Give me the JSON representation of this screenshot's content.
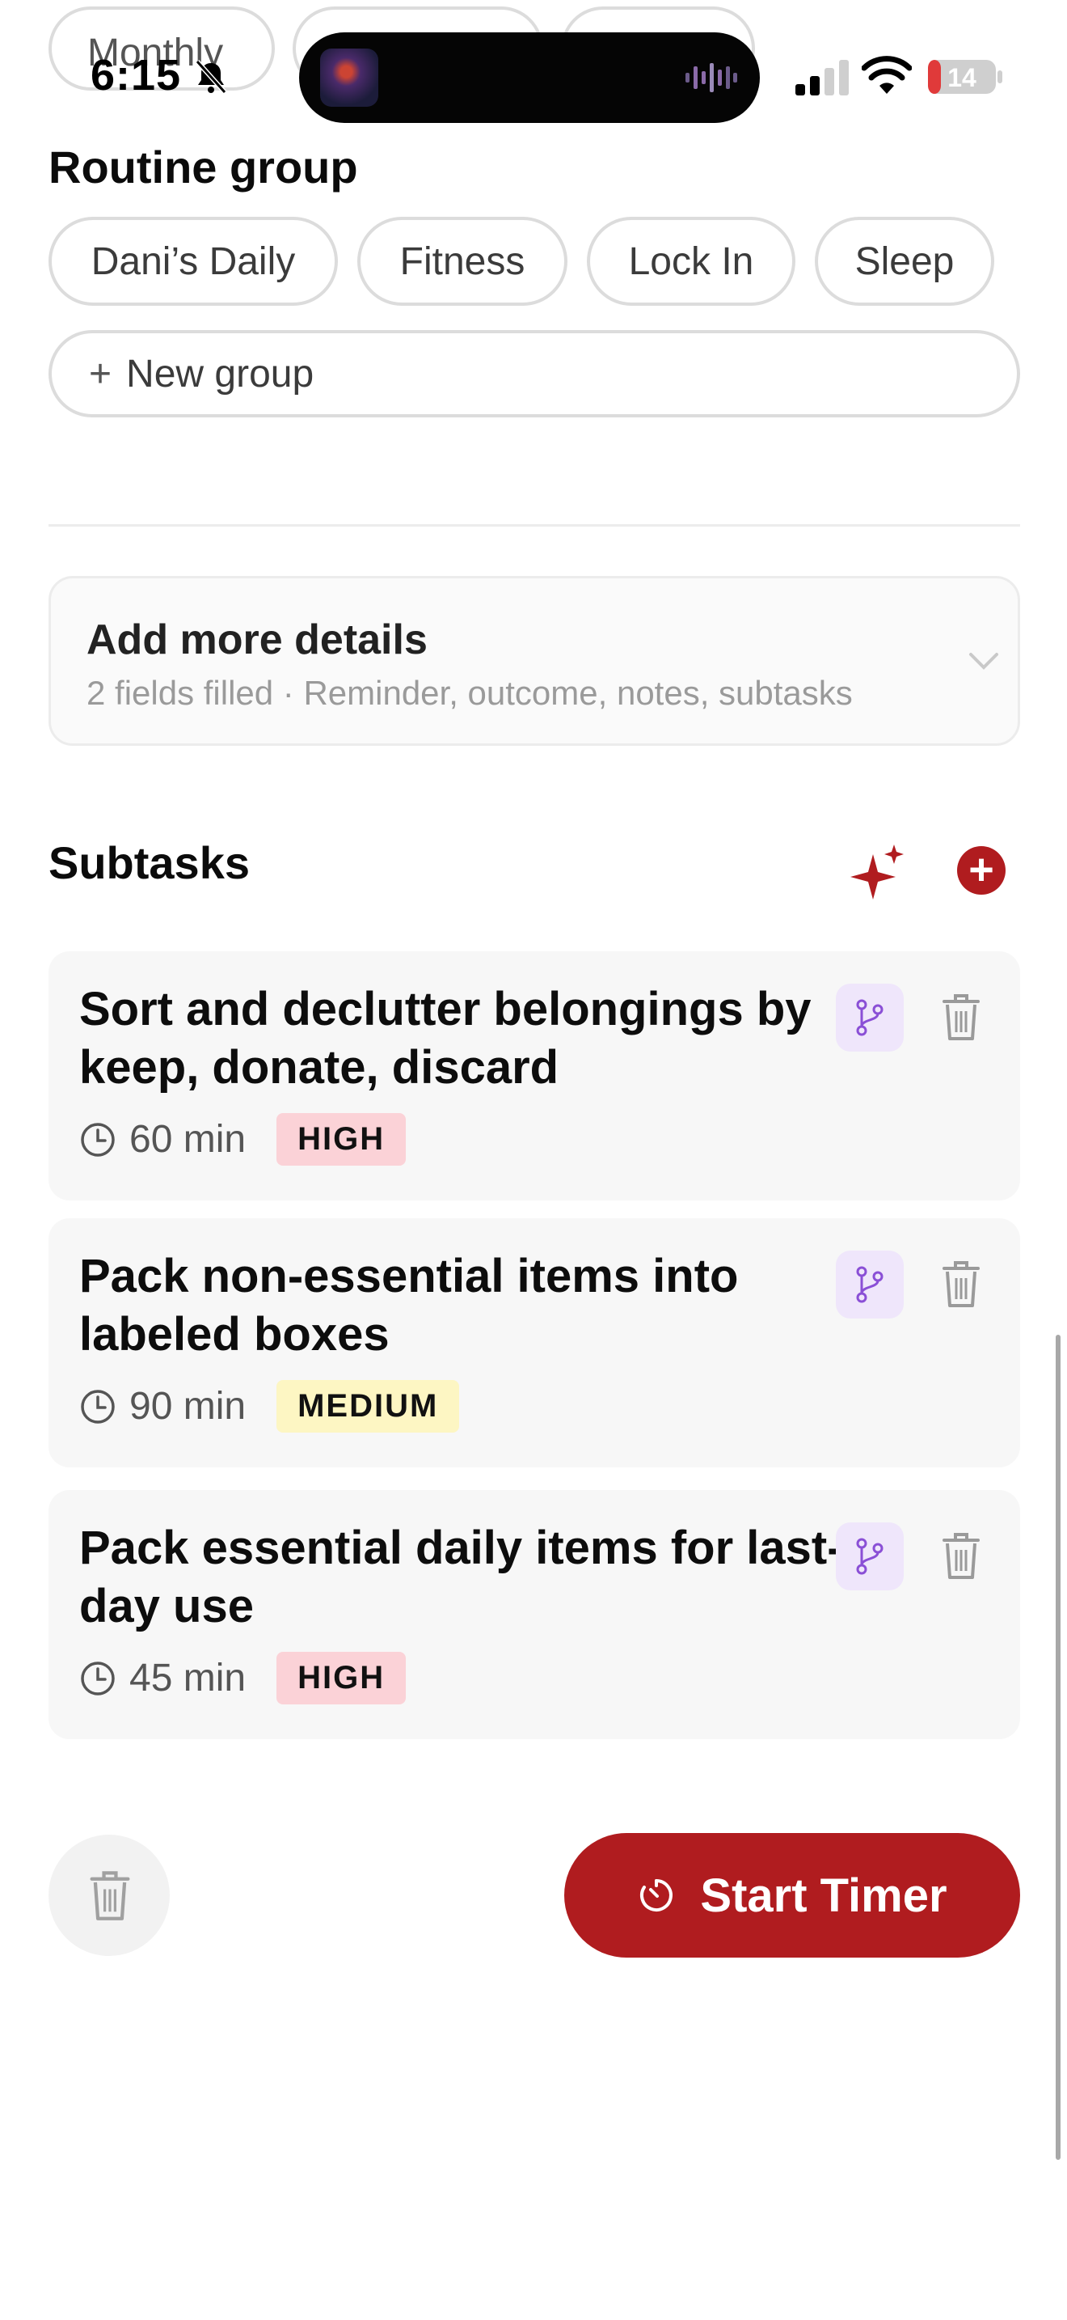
{
  "status_bar": {
    "time": "6:15",
    "battery": "14"
  },
  "frequency_chips": [
    {
      "label": "Monthly"
    },
    {
      "label": ""
    },
    {
      "label": ""
    }
  ],
  "routine_group": {
    "title": "Routine group",
    "chips": [
      {
        "label": "Dani’s Daily"
      },
      {
        "label": "Fitness"
      },
      {
        "label": "Lock In"
      },
      {
        "label": "Sleep"
      }
    ],
    "new_group_label": "New group"
  },
  "details": {
    "title": "Add more details",
    "subtitle": "2 fields filled · Reminder, outcome, notes, subtasks"
  },
  "subtasks": {
    "title": "Subtasks",
    "items": [
      {
        "title": "Sort and declutter belongings by keep, donate, discard",
        "duration": "60 min",
        "priority": "HIGH"
      },
      {
        "title": "Pack non-essential items into labeled boxes",
        "duration": "90 min",
        "priority": "MEDIUM"
      },
      {
        "title": "Pack essential daily items for last-day use",
        "duration": "45 min",
        "priority": "HIGH"
      }
    ]
  },
  "actions": {
    "start_timer_label": "Start Timer"
  },
  "colors": {
    "accent": "#b01c1f",
    "high_badge": "#fbd2d7",
    "medium_badge": "#fdf6c3",
    "branch_bg": "#efe6fb"
  }
}
